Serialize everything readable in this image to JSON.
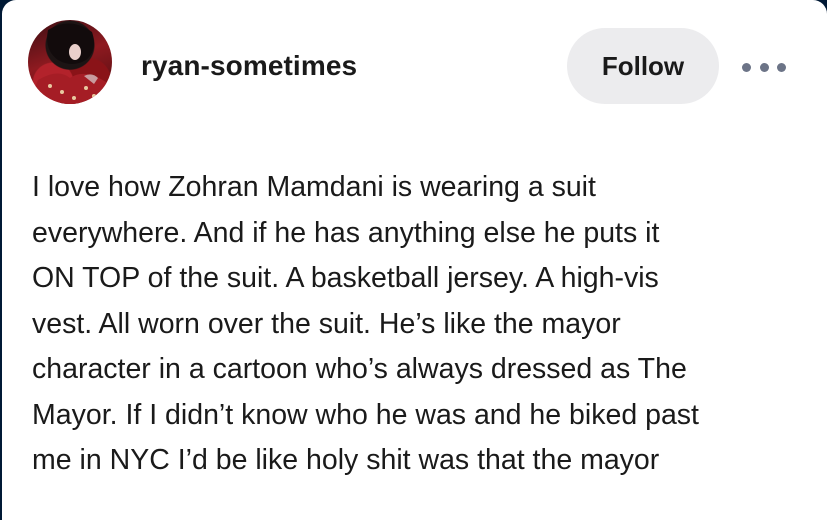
{
  "post": {
    "author": {
      "username": "ryan-sometimes"
    },
    "follow_label": "Follow",
    "more_icon": "ellipsis-horizontal-icon",
    "body_lines": [
      "I love how Zohran Mamdani is wearing a suit",
      "everywhere. And if he has anything else he puts it",
      "ON TOP of the suit. A basketball jersey. A high-vis",
      "vest. All worn over the suit. He’s like the mayor",
      "character in a cartoon who’s always dressed as The",
      "Mayor. If I didn’t know who he was and he biked past",
      "me in NYC I’d be like holy shit was that the mayor"
    ]
  },
  "colors": {
    "page_background": "#001935",
    "card_background": "#ffffff",
    "button_background": "#ececee",
    "text": "#1a1a1a",
    "more_dots": "#6c7487"
  }
}
